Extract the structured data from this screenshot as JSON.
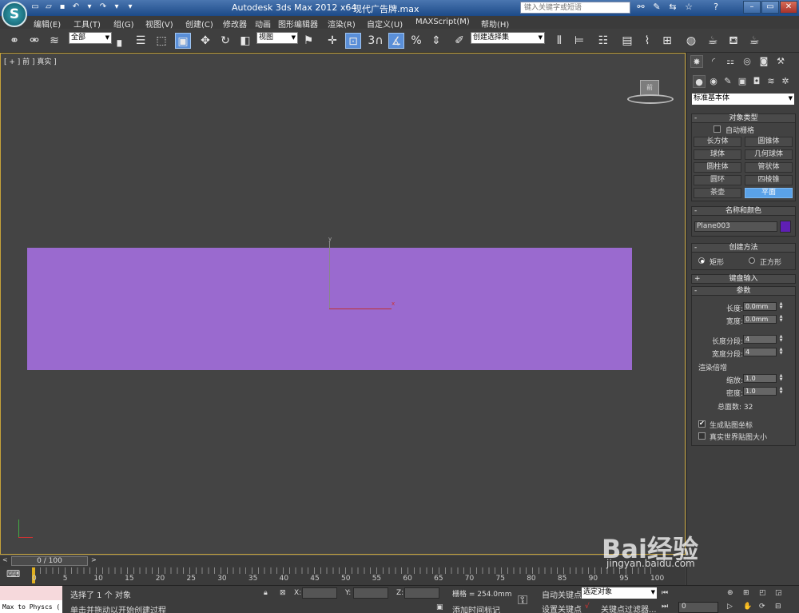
{
  "title_bar": {
    "app_title": "Autodesk 3ds Max  2012 x64",
    "file_name": "现代广告牌.max",
    "search_placeholder": "键入关键字或短语"
  },
  "menu": [
    "编辑(E)",
    "工具(T)",
    "组(G)",
    "视图(V)",
    "创建(C)",
    "修改器",
    "动画",
    "图形编辑器",
    "渲染(R)",
    "自定义(U)",
    "MAXScript(M)",
    "帮助(H)"
  ],
  "toolbar": {
    "selection_filter": "全部",
    "reference_coord": "视图",
    "named_selection": "创建选择集",
    "snap_number": "3"
  },
  "viewport": {
    "label": "[ + ] 前 ] 真实 ]",
    "viewcube_label": "前",
    "axis_x": "x",
    "axis_y": "y",
    "plane_color": "#9a6acf"
  },
  "time_slider": {
    "frame_display": "0 / 100",
    "ticks": [
      "0",
      "5",
      "10",
      "15",
      "20",
      "25",
      "30",
      "35",
      "40",
      "45",
      "50",
      "55",
      "60",
      "65",
      "70",
      "75",
      "80",
      "85",
      "90",
      "95",
      "100"
    ]
  },
  "status": {
    "script_listener": "Max to Physcs (",
    "selected": "选择了 1 个 对象",
    "prompt": "单击并拖动以开始创建过程",
    "x_label": "X:",
    "y_label": "Y:",
    "z_label": "Z:",
    "grid": "栅格 = 254.0mm",
    "add_time_tag": "添加时间标记",
    "auto_key": "自动关键点",
    "set_key": "设置关键点",
    "selected_dropdown": "选定对象",
    "key_filters": "关键点过滤器...",
    "frame_field": "0"
  },
  "command_panel": {
    "category_dropdown": "标准基本体",
    "object_type": {
      "header": "对象类型",
      "autogrid": "自动栅格",
      "buttons": [
        "长方体",
        "圆锥体",
        "球体",
        "几何球体",
        "圆柱体",
        "管状体",
        "圆环",
        "四棱锥",
        "茶壶",
        "平面"
      ],
      "active": "平面"
    },
    "name_color": {
      "header": "名称和颜色",
      "name": "Plane003",
      "color": "#5f1fb5"
    },
    "creation_method": {
      "header": "创建方法",
      "options": [
        "矩形",
        "正方形"
      ],
      "selected": "矩形"
    },
    "keyboard_entry": {
      "header": "键盘输入"
    },
    "parameters": {
      "header": "参数",
      "length_label": "长度:",
      "length": "0.0mm",
      "width_label": "宽度:",
      "width": "0.0mm",
      "length_segs_label": "长度分段:",
      "length_segs": "4",
      "width_segs_label": "宽度分段:",
      "width_segs": "4",
      "render_mult_label": "渲染倍增",
      "scale_label": "缩放:",
      "scale": "1.0",
      "density_label": "密度:",
      "density": "1.0",
      "total_faces": "总面数: 32",
      "gen_mapping": "生成贴图坐标",
      "real_world": "真实世界贴图大小"
    }
  },
  "watermark": {
    "logo": "Bai经验",
    "url": "jingyan.baidu.com"
  }
}
